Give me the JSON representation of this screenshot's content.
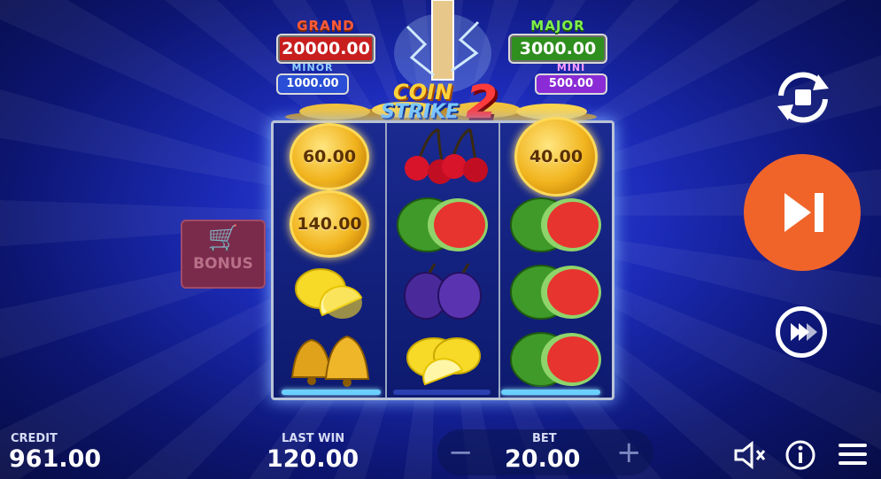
{
  "jackpots": {
    "grand": {
      "label": "GRAND",
      "value": "20000.00",
      "color": "#c81e1e"
    },
    "major": {
      "label": "MAJOR",
      "value": "3000.00",
      "color": "#2f8f1e"
    },
    "minor": {
      "label": "MINOR",
      "value": "1000.00",
      "color": "#2a4fd6"
    },
    "mini": {
      "label": "MINI",
      "value": "500.00",
      "color": "#8a2bd6"
    }
  },
  "logo": {
    "line1": "COIN",
    "line2": "STRIKE",
    "number": "2"
  },
  "reels": [
    [
      {
        "symbol": "coin",
        "value": "60.00"
      },
      {
        "symbol": "coin",
        "value": "140.00"
      },
      {
        "symbol": "lemon"
      },
      {
        "symbol": "bells"
      }
    ],
    [
      {
        "symbol": "cherries"
      },
      {
        "symbol": "watermelon"
      },
      {
        "symbol": "plums"
      },
      {
        "symbol": "lemon"
      }
    ],
    [
      {
        "symbol": "coin",
        "value": "40.00"
      },
      {
        "symbol": "watermelon"
      },
      {
        "symbol": "watermelon"
      },
      {
        "symbol": "watermelon"
      }
    ]
  ],
  "bonus": {
    "label": "BONUS",
    "icon": "shopping-cart-icon"
  },
  "controls": {
    "autoplay_icon": "autoplay-stop-icon",
    "spin_icon": "skip-forward-icon",
    "turbo_icon": "fast-forward-icon",
    "spin_color": "#f0642a"
  },
  "credit": {
    "label": "CREDIT",
    "value": "961.00"
  },
  "last_win": {
    "label": "LAST WIN",
    "value": "120.00"
  },
  "bet": {
    "label": "BET",
    "value": "20.00",
    "minus": "−",
    "plus": "+"
  },
  "bottom_icons": [
    "sound-muted-icon",
    "info-icon",
    "menu-icon"
  ]
}
